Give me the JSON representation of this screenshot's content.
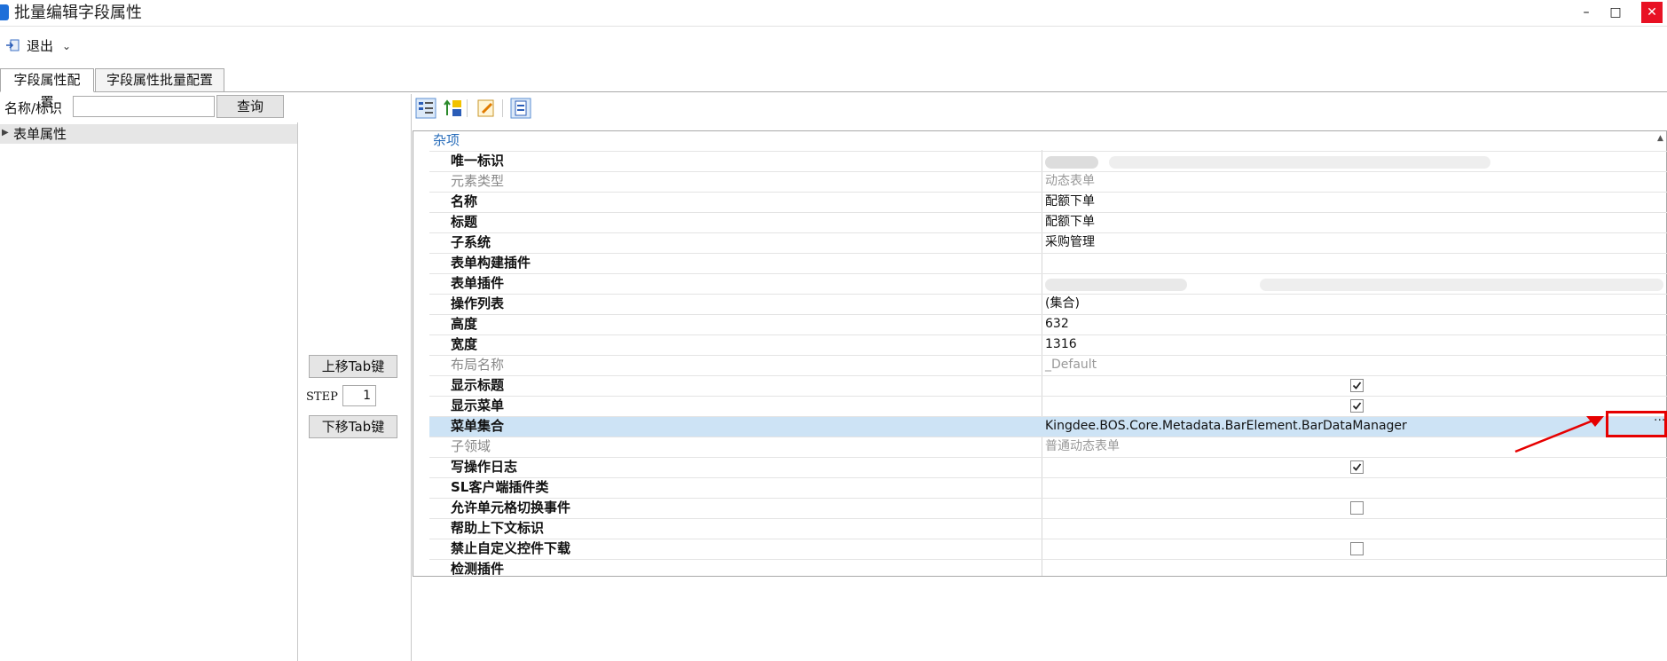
{
  "window": {
    "title": "批量编辑字段属性",
    "minimize": "–",
    "maximize": "□",
    "close": "✕"
  },
  "toolbar": {
    "exit_label": "退出",
    "exit_icon": "exit-icon",
    "dropdown_icon": "chevron-down-icon"
  },
  "tabs": [
    {
      "label": "字段属性配置",
      "active": true
    },
    {
      "label": "字段属性批量配置",
      "active": false
    }
  ],
  "search": {
    "label": "名称/标识",
    "value": "",
    "button": "查询"
  },
  "tree": {
    "root_label": "表单属性"
  },
  "middle": {
    "move_up": "上移Tab键",
    "step_label": "STEP",
    "step_value": "1",
    "move_down": "下移Tab键"
  },
  "grid_toolbar": {
    "icons": [
      "categorized-icon",
      "sort-alpha-icon",
      "edit-icon",
      "property-page-icon"
    ]
  },
  "grid": {
    "category": "杂项",
    "rows": [
      {
        "name": "唯一标识",
        "value": "",
        "dim": false
      },
      {
        "name": "元素类型",
        "value": "动态表单",
        "dim": true
      },
      {
        "name": "名称",
        "value": "配额下单",
        "dim": false
      },
      {
        "name": "标题",
        "value": "配额下单",
        "dim": false
      },
      {
        "name": "子系统",
        "value": "采购管理",
        "dim": false
      },
      {
        "name": "表单构建插件",
        "value": "",
        "dim": false
      },
      {
        "name": "表单插件",
        "value": "",
        "dim": false
      },
      {
        "name": "操作列表",
        "value": "(集合)",
        "dim": false
      },
      {
        "name": "高度",
        "value": "632",
        "dim": false
      },
      {
        "name": "宽度",
        "value": "1316",
        "dim": false
      },
      {
        "name": "布局名称",
        "value": "_Default",
        "dim": true
      },
      {
        "name": "显示标题",
        "value": "",
        "dim": false,
        "checkbox": true
      },
      {
        "name": "显示菜单",
        "value": "",
        "dim": false,
        "checkbox": true
      },
      {
        "name": "菜单集合",
        "value": "Kingdee.BOS.Core.Metadata.BarElement.BarDataManager",
        "dim": false,
        "selected": true
      },
      {
        "name": "子领域",
        "value": "普通动态表单",
        "dim": true
      },
      {
        "name": "写操作日志",
        "value": "",
        "dim": false,
        "checkbox": true
      },
      {
        "name": "SL客户端插件类",
        "value": "",
        "dim": false
      },
      {
        "name": "允许单元格切换事件",
        "value": "",
        "dim": false,
        "checkbox": false
      },
      {
        "name": "帮助上下文标识",
        "value": "",
        "dim": false
      },
      {
        "name": "禁止自定义控件下载",
        "value": "",
        "dim": false,
        "checkbox": false
      },
      {
        "name": "检测插件",
        "value": "",
        "dim": false
      }
    ],
    "ellipsis": "···"
  },
  "colors": {
    "accent": "#2a6ebb",
    "selected_row": "#cde3f5",
    "annotation": "#e60000"
  }
}
